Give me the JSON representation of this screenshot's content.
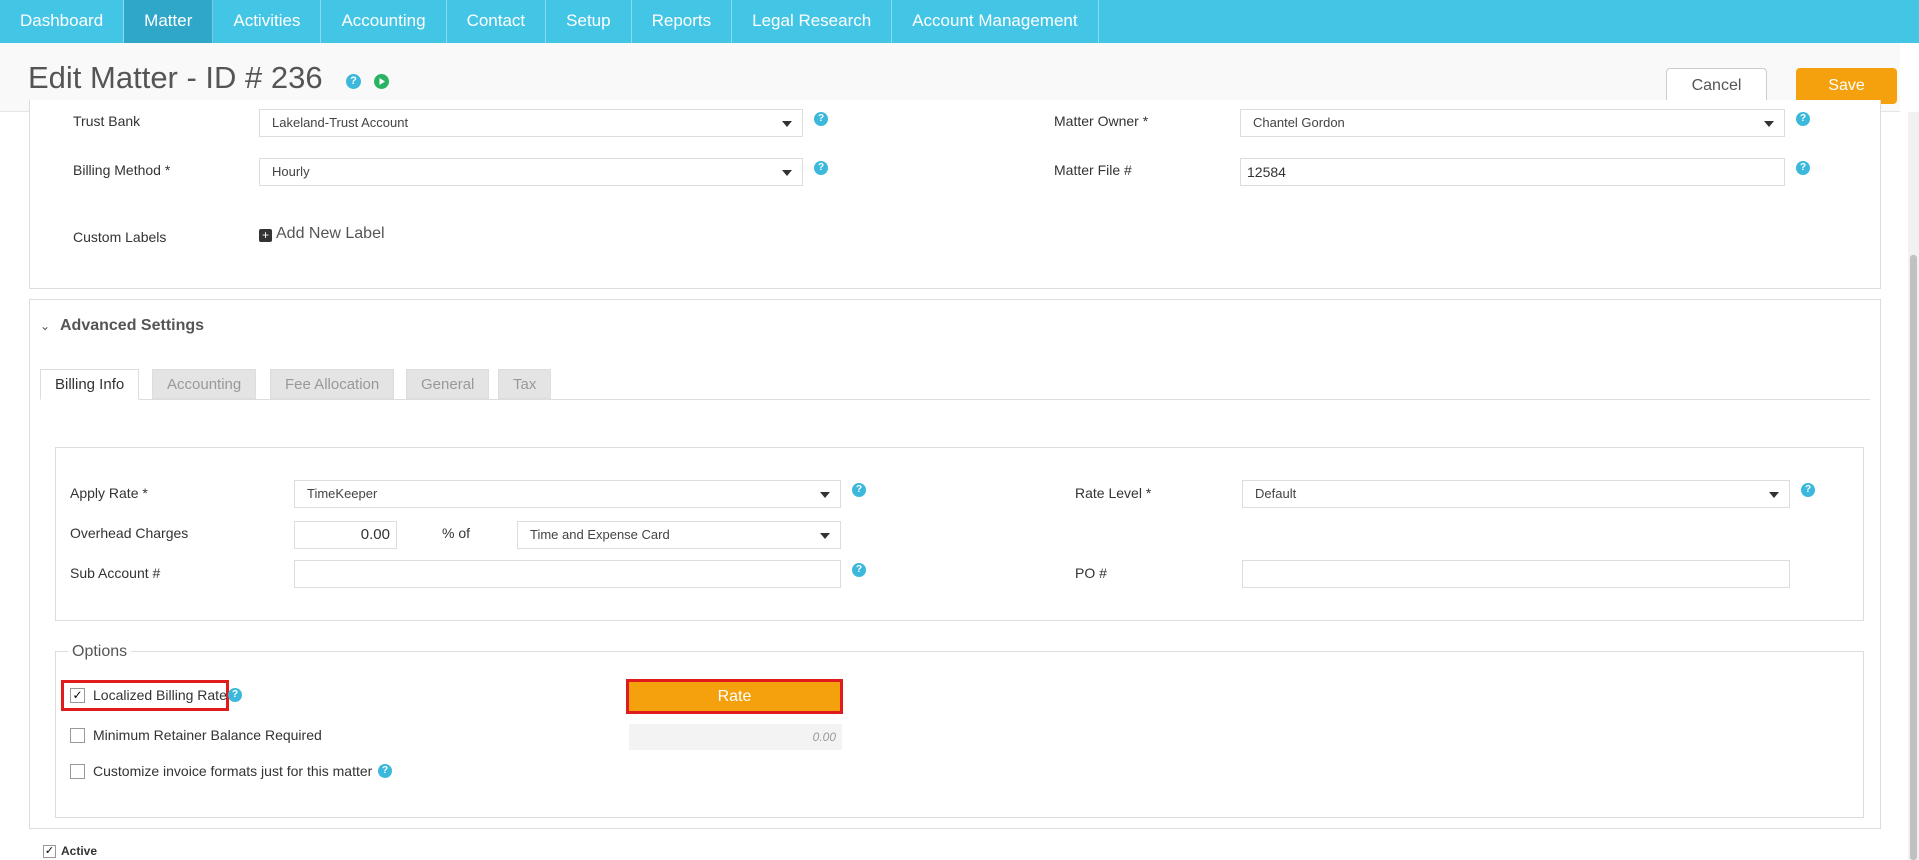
{
  "nav": {
    "items": [
      "Dashboard",
      "Matter",
      "Activities",
      "Accounting",
      "Contact",
      "Setup",
      "Reports",
      "Legal Research",
      "Account Management"
    ],
    "active": "Matter"
  },
  "header": {
    "title": "Edit Matter - ID # 236",
    "cancel_label": "Cancel",
    "save_label": "Save"
  },
  "top_form": {
    "trust_bank": {
      "label": "Trust Bank",
      "value": "Lakeland-Trust Account"
    },
    "billing_method": {
      "label": "Billing Method *",
      "value": "Hourly"
    },
    "custom_labels": {
      "label": "Custom Labels",
      "add_label": "Add New Label"
    },
    "matter_owner": {
      "label": "Matter Owner *",
      "value": "Chantel Gordon"
    },
    "matter_file": {
      "label": "Matter File #",
      "value": "12584"
    }
  },
  "advanced": {
    "title": "Advanced Settings",
    "tabs": [
      "Billing Info",
      "Accounting",
      "Fee Allocation",
      "General",
      "Tax"
    ],
    "active_tab": "Billing Info"
  },
  "billing_info": {
    "apply_rate": {
      "label": "Apply Rate *",
      "value": "TimeKeeper"
    },
    "overhead": {
      "label": "Overhead Charges",
      "value": "0.00",
      "pct_of": "% of",
      "basis": "Time and Expense Card"
    },
    "sub_account": {
      "label": "Sub Account #",
      "value": ""
    },
    "rate_level": {
      "label": "Rate Level *",
      "value": "Default"
    },
    "po": {
      "label": "PO #",
      "value": ""
    }
  },
  "options": {
    "legend": "Options",
    "localized_billing_rate": {
      "label": "Localized Billing Rate",
      "checked": true
    },
    "rate_button": "Rate",
    "minimum_retainer": {
      "label": "Minimum Retainer Balance Required",
      "checked": false,
      "value": "0.00"
    },
    "customize_invoice": {
      "label": "Customize invoice formats just for this matter",
      "checked": false
    }
  },
  "active": {
    "label": "Active",
    "checked": true
  },
  "colors": {
    "nav_bg": "#43c6e6",
    "nav_active_bg": "#2fa7c8",
    "accent_orange": "#f5a10e",
    "help_icon": "#3cb8dc",
    "highlight_red": "#e01b1b"
  }
}
